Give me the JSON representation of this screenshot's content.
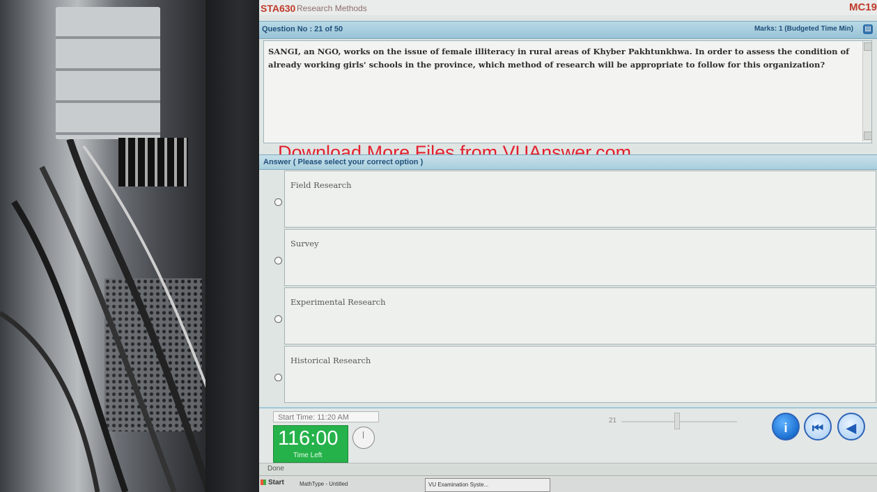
{
  "course": {
    "code": "STA630",
    "name": "Research Methods",
    "right_code": "MC19"
  },
  "question": {
    "number_label": "Question No : 21 of 50",
    "marks_label": "Marks: 1 (Budgeted Time Min)",
    "text": "SANGI, an NGO, works on the issue of female illiteracy in rural areas of Khyber Pakhtunkhwa. In order to assess the condition of already working girls' schools in the province, which method of research will be appropriate to follow for this organization?",
    "watermark": "Download More Files from VUAnswer.com"
  },
  "answer": {
    "header": "Answer ( Please select your correct option )",
    "options": [
      {
        "label": "Field Research"
      },
      {
        "label": "Survey"
      },
      {
        "label": "Experimental Research"
      },
      {
        "label": "Historical Research"
      }
    ]
  },
  "footer": {
    "start_time": "Start Time: 11:20 AM",
    "time_value": "116:00",
    "time_label": "Time Left",
    "slider_value": "21"
  },
  "statusbar": {
    "text": "Done"
  },
  "taskbar": {
    "start": "Start",
    "item1": "MathType - Untitled",
    "item2": "VU Examination Syste..."
  }
}
